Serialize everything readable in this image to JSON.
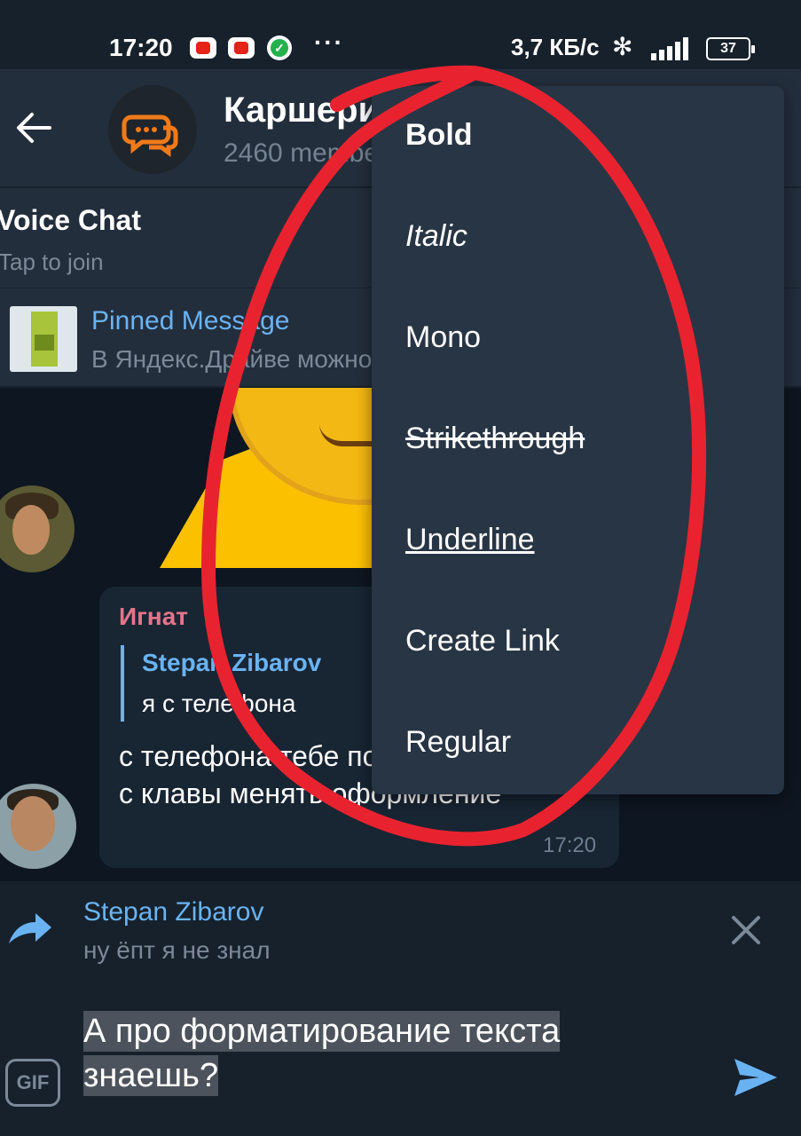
{
  "status_bar": {
    "time": "17:20",
    "dots": "···",
    "network_speed": "3,7 КБ/с",
    "bluetooth_icon": "✻",
    "battery": "37"
  },
  "header": {
    "title": "Каршеринг",
    "subtitle": "2460 members"
  },
  "voice_chat": {
    "title": "Voice Chat",
    "subtitle": "Tap to join"
  },
  "pinned": {
    "title": "Pinned Message",
    "text": "В Яндекс.Драйве можно"
  },
  "message": {
    "sender": "Игнат",
    "quote_name": "Stepan Zibarov",
    "quote_text": "я с телефона",
    "text": "с телефона тебе показать как можно с клавы менять оформление",
    "time": "17:20"
  },
  "reply_bar": {
    "name": "Stepan Zibarov",
    "text": "ну ёпт я не знал"
  },
  "input": {
    "gif_label": "GIF",
    "text": "А про форматирование текста знаешь?"
  },
  "format_menu": {
    "items": [
      "Bold",
      "Italic",
      "Mono",
      "Strikethrough",
      "Underline",
      "Create Link",
      "Regular"
    ]
  },
  "colors": {
    "background": "#0e1621",
    "panel": "#232e3c",
    "accent": "#6ab3f3",
    "annotation": "#e8232f"
  }
}
